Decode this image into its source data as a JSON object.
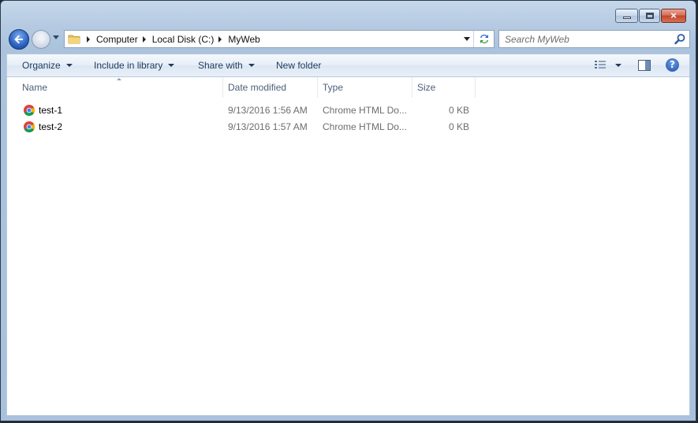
{
  "window": {
    "caption_close_glyph": "×"
  },
  "address": {
    "crumbs": [
      "Computer",
      "Local Disk (C:)",
      "MyWeb"
    ]
  },
  "search": {
    "placeholder": "Search MyWeb"
  },
  "toolbar": {
    "organize": "Organize",
    "include_in_library": "Include in library",
    "share_with": "Share with",
    "new_folder": "New folder",
    "help_glyph": "?"
  },
  "columns": {
    "name": "Name",
    "date_modified": "Date modified",
    "type": "Type",
    "size": "Size"
  },
  "files": [
    {
      "name": "test-1",
      "date": "9/13/2016 1:56 AM",
      "type": "Chrome HTML Do...",
      "size": "0 KB"
    },
    {
      "name": "test-2",
      "date": "9/13/2016 1:57 AM",
      "type": "Chrome HTML Do...",
      "size": "0 KB"
    }
  ],
  "icons": {
    "back": "back-arrow-icon",
    "forward": "forward-arrow-icon",
    "folder": "folder-icon",
    "refresh": "refresh-icon",
    "search": "magnifier-icon",
    "views": "details-view-icon",
    "preview": "preview-pane-icon",
    "help": "help-icon",
    "file": "chrome-icon"
  },
  "colors": {
    "frame": "#abc3dd",
    "link_text": "#1e395b",
    "meta_text": "#6d6d6d",
    "back_button": "#2a62c2"
  }
}
